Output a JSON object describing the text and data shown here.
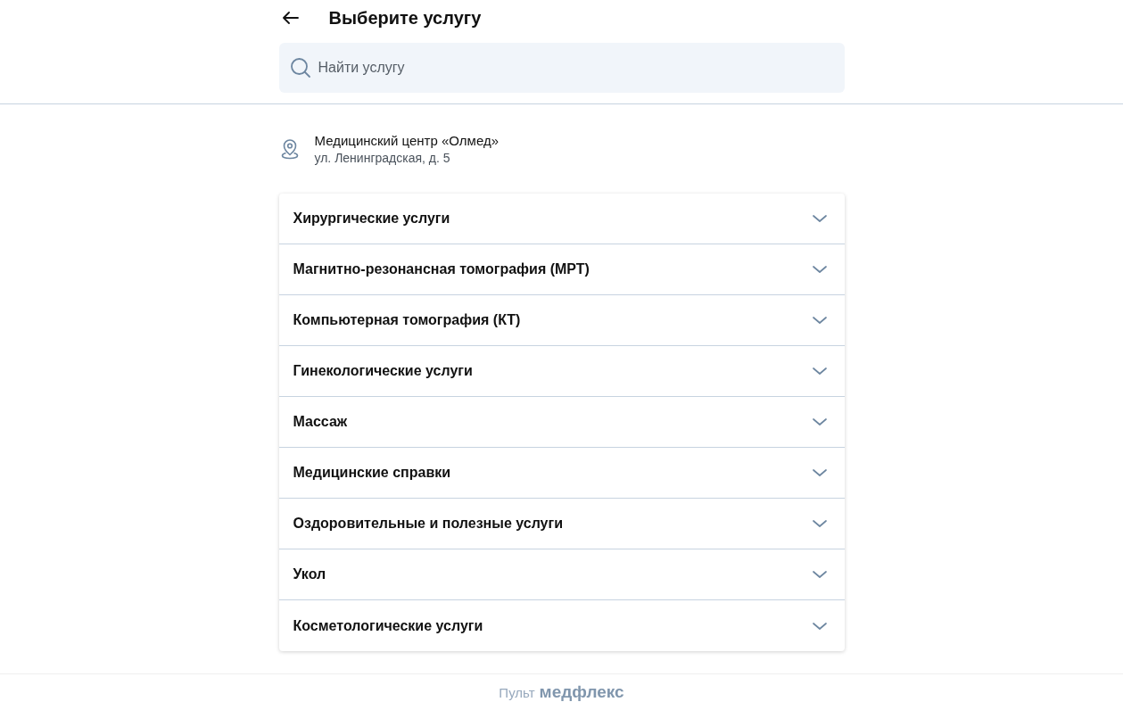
{
  "header": {
    "title": "Выберите услугу"
  },
  "search": {
    "placeholder": "Найти услугу"
  },
  "clinic": {
    "name": "Медицинский центр «Олмед»",
    "address": "ул. Ленинградская, д. 5"
  },
  "categories": [
    {
      "label": "Хирургические услуги",
      "expanded": false
    },
    {
      "label": "Магнитно-резонансная томография (МРТ)",
      "expanded": false
    },
    {
      "label": "Компьютерная томография (КТ)",
      "expanded": false
    },
    {
      "label": "Гинекологические услуги",
      "expanded": false
    },
    {
      "label": "Массаж",
      "expanded": false
    },
    {
      "label": "Медицинские справки",
      "expanded": false
    },
    {
      "label": "Оздоровительные и полезные услуги",
      "expanded": false
    },
    {
      "label": "Укол",
      "expanded": false
    },
    {
      "label": "Косметологические услуги",
      "expanded": false
    }
  ],
  "footer": {
    "prefix": "Пульт",
    "brand": "медфлекс"
  }
}
